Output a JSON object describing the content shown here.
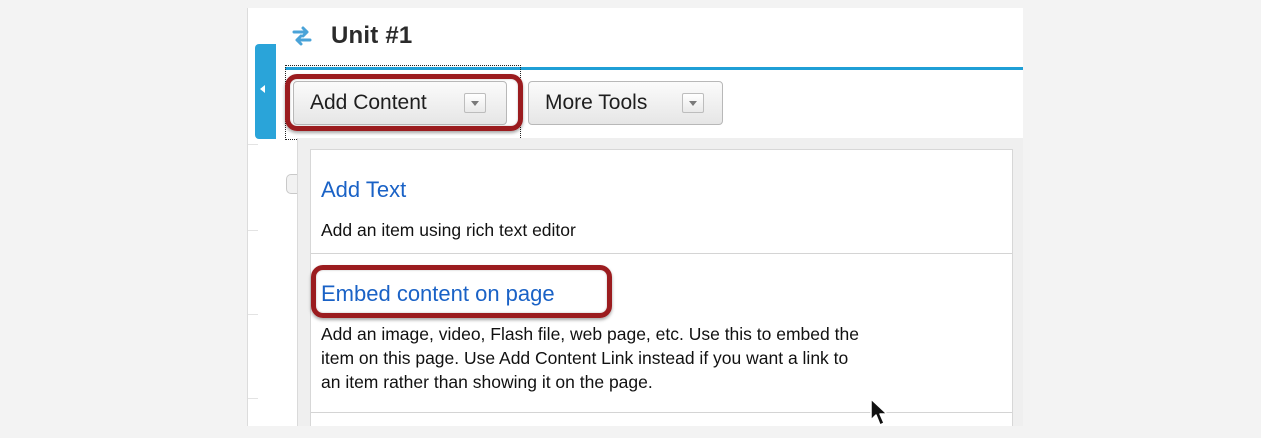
{
  "page": {
    "title": "Unit #1"
  },
  "toolbar": {
    "add_content_label": "Add Content",
    "more_tools_label": "More Tools"
  },
  "menu": {
    "items": [
      {
        "title": "Add Text",
        "description": "Add an item using rich text editor"
      },
      {
        "title": "Embed content on page",
        "description_lines": [
          "Add an image, video, Flash file, web page, etc. Use this to embed the",
          "item on this page. Use Add Content Link instead if you want a link to",
          "an item rather than showing it on the page."
        ]
      }
    ]
  },
  "colors": {
    "accent": "#1f9fd6",
    "highlight": "#9b1c1f",
    "link": "#1a62c6"
  },
  "icons": {
    "unit": "swap-arrows-icon",
    "collapse": "collapse-arrow-icon",
    "pointer": "mouse-cursor-icon"
  }
}
